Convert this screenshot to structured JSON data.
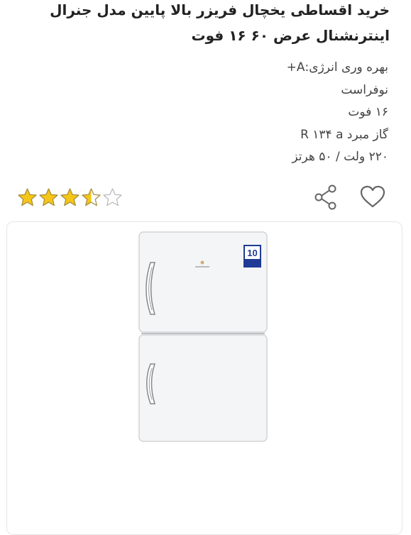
{
  "product": {
    "title": "خرید اقساطی یخچال فریزر بالا پایین مدل جنرال اینترنشنال عرض ۶۰ ۱۶ فوت",
    "features": [
      "بهره وری انرژی:A+",
      "نوفراست",
      "۱۶ فوت",
      "گاز مبرد R ۱۳۴ a",
      "۲۲۰ ولت / ۵۰ هرتز"
    ],
    "rating": 3.5,
    "rating_max": 5
  },
  "actions": {
    "favorite_icon": "heart-icon",
    "share_icon": "share-icon"
  },
  "image": {
    "energy_label": "10",
    "colors": {
      "star_fill": "#f5c518",
      "star_stroke": "#b7b7b7",
      "icon": "#666666",
      "border": "#e6e6e6"
    }
  }
}
